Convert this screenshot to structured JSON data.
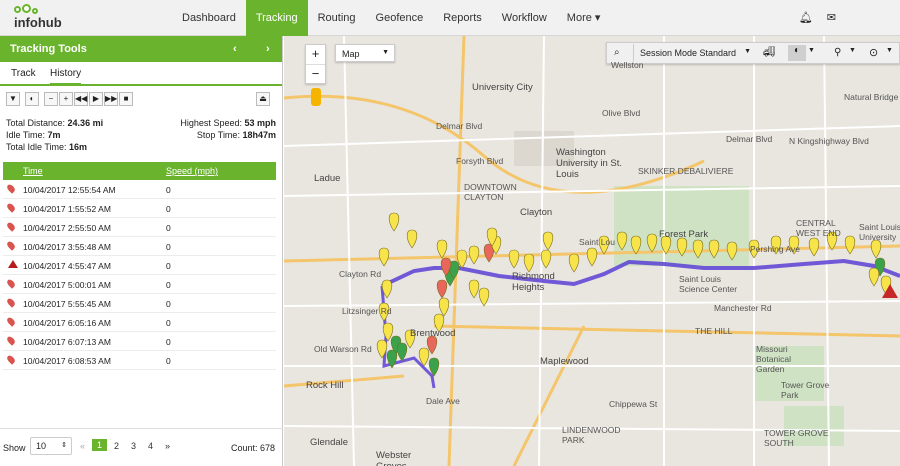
{
  "app": {
    "logo_text": "infohub",
    "brand_color": "#6ab42d"
  },
  "nav": {
    "items": [
      {
        "label": "Dashboard"
      },
      {
        "label": "Tracking"
      },
      {
        "label": "Routing"
      },
      {
        "label": "Geofence"
      },
      {
        "label": "Reports"
      },
      {
        "label": "Workflow"
      },
      {
        "label": "More ▾"
      }
    ],
    "active": "Tracking",
    "icons": [
      "bell-icon",
      "envelope-icon"
    ]
  },
  "panel": {
    "title": "Tracking Tools",
    "tabs": [
      {
        "label": "Track"
      },
      {
        "label": "History"
      }
    ],
    "active_tab": "History",
    "stats": {
      "total_distance_label": "Total Distance:",
      "total_distance": "24.36 mi",
      "highest_speed_label": "Highest Speed:",
      "highest_speed": "53 mph",
      "idle_time_label": "Idle Time:",
      "idle_time": "7m",
      "stop_time_label": "Stop Time:",
      "stop_time": "18h47m",
      "total_idle_label": "Total Idle Time:",
      "total_idle": "16m"
    },
    "table": {
      "headers": [
        "Time",
        "Speed (mph)"
      ],
      "rows": [
        {
          "time": "10/04/2017 12:55:54 AM",
          "speed": "0",
          "marker": "red-pin"
        },
        {
          "time": "10/04/2017 1:55:52 AM",
          "speed": "0",
          "marker": "red-pin"
        },
        {
          "time": "10/04/2017 2:55:50 AM",
          "speed": "0",
          "marker": "red-pin"
        },
        {
          "time": "10/04/2017 3:55:48 AM",
          "speed": "0",
          "marker": "red-pin"
        },
        {
          "time": "10/04/2017 4:55:47 AM",
          "speed": "0",
          "marker": "warning-triangle"
        },
        {
          "time": "10/04/2017 5:00:01 AM",
          "speed": "0",
          "marker": "red-pin"
        },
        {
          "time": "10/04/2017 5:55:45 AM",
          "speed": "0",
          "marker": "red-pin"
        },
        {
          "time": "10/04/2017 6:05:16 AM",
          "speed": "0",
          "marker": "red-pin"
        },
        {
          "time": "10/04/2017 6:07:13 AM",
          "speed": "0",
          "marker": "red-pin"
        },
        {
          "time": "10/04/2017 6:08:53 AM",
          "speed": "0",
          "marker": "red-pin"
        }
      ]
    },
    "footer": {
      "show_label": "Show",
      "page_size": "10",
      "pages": [
        "«",
        "1",
        "2",
        "3",
        "4",
        "»"
      ],
      "current_page": "1",
      "count_label": "Count: 678"
    }
  },
  "map": {
    "type_select": "Map",
    "session_mode": "Session Mode Standard",
    "labels": [
      "Wellston",
      "University City",
      "Olive Blvd",
      "Delmar Blvd",
      "Washington University in St. Louis",
      "SKINKER DEBALIVIERE",
      "DOWNTOWN CLAYTON",
      "Ladue",
      "Clayton",
      "Forest Park",
      "CENTRAL WEST END",
      "Saint Louis University",
      "Saint Lou",
      "Richmond Heights",
      "Saint Louis Science Center",
      "Brentwood",
      "Old Warson Rd",
      "Maplewood",
      "THE HILL",
      "Missouri Botanical Garden",
      "Rock Hill",
      "Tower Grove Park",
      "LINDENWOOD PARK",
      "TOWER GROVE SOUTH",
      "Glendale",
      "Webster Groves",
      "Manchester Rd",
      "Chippewa St",
      "Clayton Rd",
      "Litzsinger Rd",
      "Pershing Ave",
      "Dale Ave",
      "Delmar Blvd",
      "Forsyth Blvd",
      "N Kingshighway Blvd",
      "Natural Bridge Ave"
    ]
  }
}
